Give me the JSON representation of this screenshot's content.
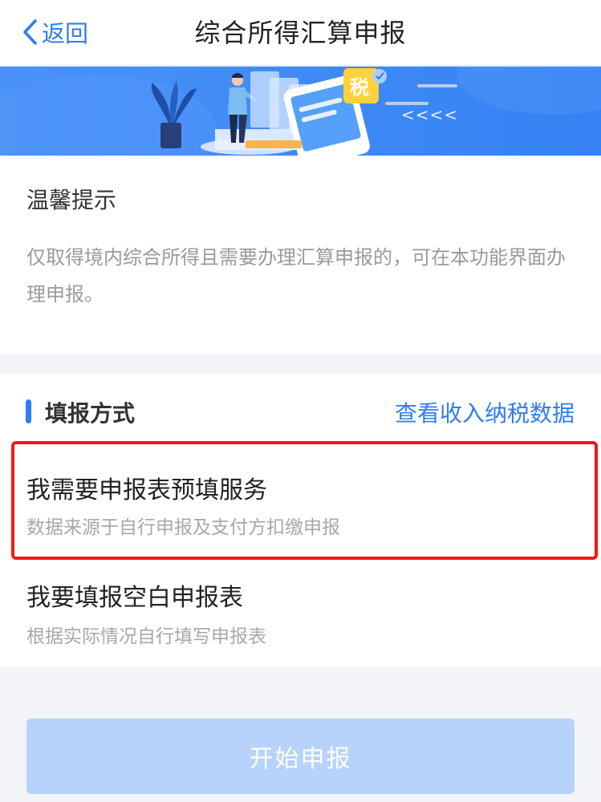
{
  "header": {
    "back_label": "返回",
    "title": "综合所得汇算申报"
  },
  "banner": {
    "tax_badge": "税",
    "arrows": "<<<<"
  },
  "tip": {
    "title": "温馨提示",
    "body": "仅取得境内综合所得且需要办理汇算申报的，可在本功能界面办理申报。"
  },
  "method": {
    "section_title": "填报方式",
    "view_link": "查看收入纳税数据",
    "options": [
      {
        "title": "我需要申报表预填服务",
        "subtitle": "数据来源于自行申报及支付方扣缴申报"
      },
      {
        "title": "我要填报空白申报表",
        "subtitle": "根据实际情况自行填写申报表"
      }
    ]
  },
  "footer": {
    "start_button": "开始申报"
  },
  "colors": {
    "accent": "#2f7cf6",
    "highlight": "#f01818",
    "disabled_button": "#b7d3fb"
  },
  "icons": {
    "back": "chevron-left-icon"
  }
}
